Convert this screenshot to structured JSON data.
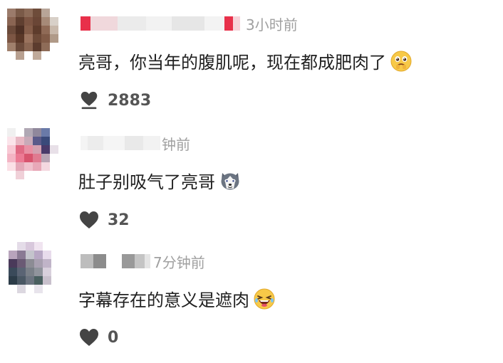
{
  "comments": [
    {
      "time": "3小时前",
      "text": "亮哥，你当年的腹肌呢，现在都成肥肉了",
      "emoji": "pleading-face-emoji",
      "likes": "2883"
    },
    {
      "time": "钟前",
      "text": "肚子别吸气了亮哥",
      "emoji": "husky-face-emoji",
      "likes": "32"
    },
    {
      "time": "7分钟前",
      "text": "字幕存在的意义是遮肉",
      "emoji": "laughing-face-emoji",
      "likes": "0"
    }
  ],
  "icons": {
    "like": "heart-icon"
  },
  "colors": {
    "heart": "#444444",
    "time": "#a0a0a0",
    "text": "#202020",
    "count": "#555555",
    "name_accent": "#e8304a"
  }
}
